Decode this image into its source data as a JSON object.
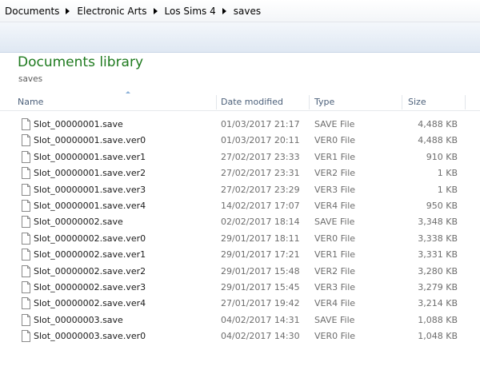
{
  "breadcrumb": [
    "Documents",
    "Electronic Arts",
    "Los Sims 4",
    "saves"
  ],
  "library": {
    "title": "Documents library",
    "subtitle": "saves"
  },
  "columns": {
    "name": "Name",
    "date": "Date modified",
    "type": "Type",
    "size": "Size"
  },
  "files": [
    {
      "name": "Slot_00000001.save",
      "date": "01/03/2017 21:17",
      "type": "SAVE File",
      "size": "4,488 KB"
    },
    {
      "name": "Slot_00000001.save.ver0",
      "date": "01/03/2017 20:11",
      "type": "VER0 File",
      "size": "4,488 KB"
    },
    {
      "name": "Slot_00000001.save.ver1",
      "date": "27/02/2017 23:33",
      "type": "VER1 File",
      "size": "910 KB"
    },
    {
      "name": "Slot_00000001.save.ver2",
      "date": "27/02/2017 23:31",
      "type": "VER2 File",
      "size": "1 KB"
    },
    {
      "name": "Slot_00000001.save.ver3",
      "date": "27/02/2017 23:29",
      "type": "VER3 File",
      "size": "1 KB"
    },
    {
      "name": "Slot_00000001.save.ver4",
      "date": "14/02/2017 17:07",
      "type": "VER4 File",
      "size": "950 KB"
    },
    {
      "name": "Slot_00000002.save",
      "date": "02/02/2017 18:14",
      "type": "SAVE File",
      "size": "3,348 KB"
    },
    {
      "name": "Slot_00000002.save.ver0",
      "date": "29/01/2017 18:11",
      "type": "VER0 File",
      "size": "3,338 KB"
    },
    {
      "name": "Slot_00000002.save.ver1",
      "date": "29/01/2017 17:21",
      "type": "VER1 File",
      "size": "3,331 KB"
    },
    {
      "name": "Slot_00000002.save.ver2",
      "date": "29/01/2017 15:48",
      "type": "VER2 File",
      "size": "3,280 KB"
    },
    {
      "name": "Slot_00000002.save.ver3",
      "date": "29/01/2017 15:45",
      "type": "VER3 File",
      "size": "3,279 KB"
    },
    {
      "name": "Slot_00000002.save.ver4",
      "date": "27/01/2017 19:42",
      "type": "VER4 File",
      "size": "3,214 KB"
    },
    {
      "name": "Slot_00000003.save",
      "date": "04/02/2017 14:31",
      "type": "SAVE File",
      "size": "1,088 KB"
    },
    {
      "name": "Slot_00000003.save.ver0",
      "date": "04/02/2017 14:30",
      "type": "VER0 File",
      "size": "1,048 KB"
    }
  ]
}
